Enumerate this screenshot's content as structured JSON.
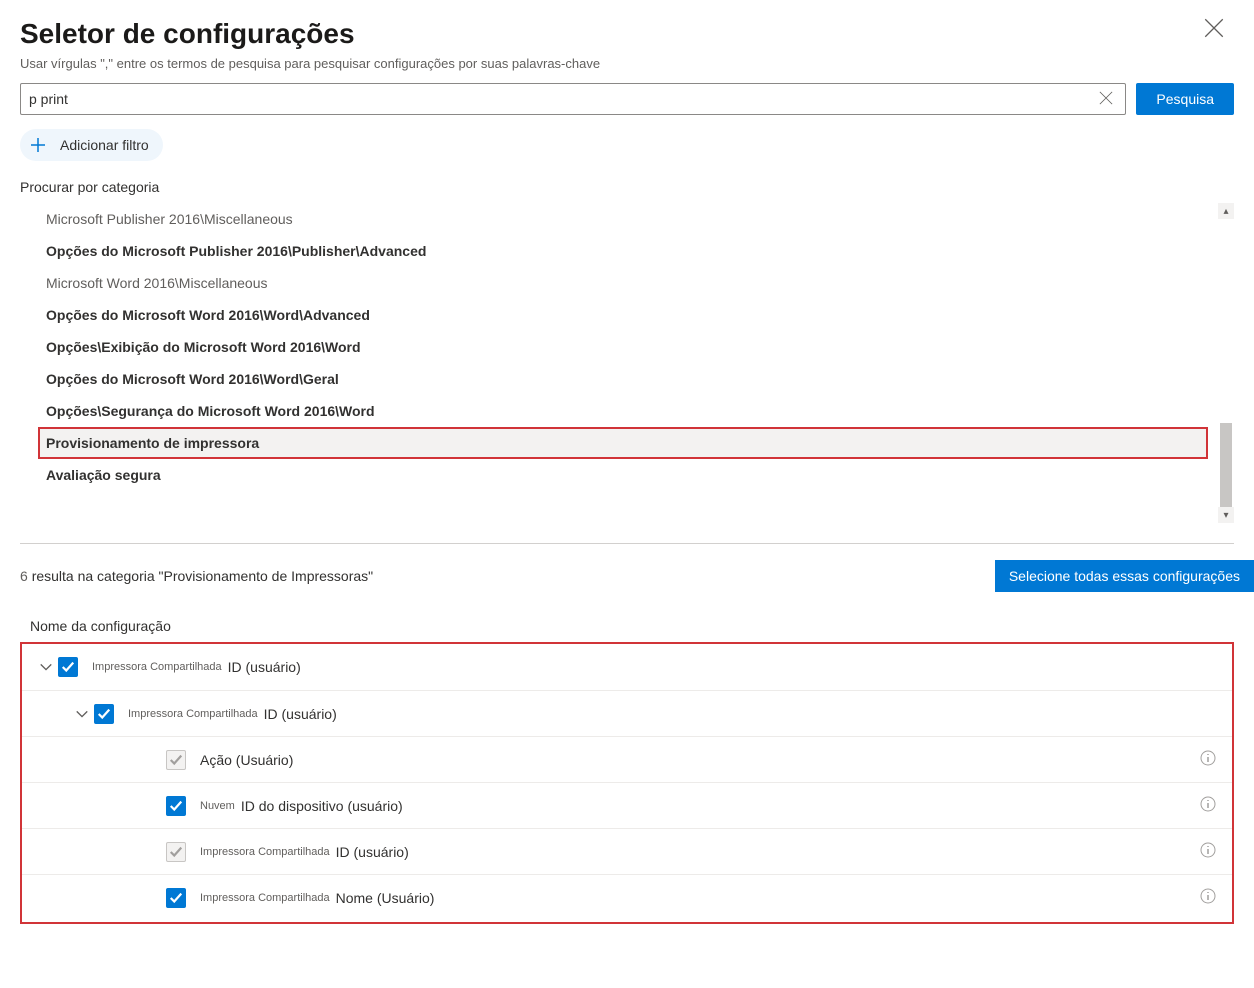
{
  "title": "Seletor de configurações",
  "hint": "Usar vírgulas \",\" entre os termos de pesquisa para pesquisar configurações por suas palavras-chave",
  "search": {
    "value": "p print",
    "button": "Pesquisa"
  },
  "add_filter": "Adicionar filtro",
  "browse_label": "Procurar por categoria",
  "categories": [
    {
      "label": "Microsoft Publisher 2016\\Miscellaneous",
      "style": "light"
    },
    {
      "label": "Opções do Microsoft Publisher 2016\\Publisher\\Advanced",
      "style": "bold"
    },
    {
      "label": "Microsoft Word 2016\\Miscellaneous",
      "style": "light"
    },
    {
      "label": "Opções do Microsoft Word 2016\\Word\\Advanced",
      "style": "bold"
    },
    {
      "label": "Opções\\Exibição do Microsoft Word 2016\\Word",
      "style": "bold"
    },
    {
      "label": "Opções do Microsoft Word 2016\\Word\\Geral",
      "style": "bold"
    },
    {
      "label": "Opções\\Segurança do Microsoft Word 2016\\Word",
      "style": "bold"
    },
    {
      "label": "Provisionamento de impressora",
      "style": "bold",
      "selected": true
    },
    {
      "label": "Avaliação segura",
      "style": "bold"
    }
  ],
  "results_count": "6",
  "results_text": "resulta na categoria \"Provisionamento de Impressoras\"",
  "select_all_button": "Selecione todas essas configurações",
  "column_header": "Nome da configuração",
  "tree": [
    {
      "level": 0,
      "chevron": true,
      "checked": "checked",
      "prefix": "Impressora Compartilhada",
      "label": "ID (usuário)",
      "info": false
    },
    {
      "level": 1,
      "chevron": true,
      "checked": "checked",
      "prefix": "Impressora Compartilhada",
      "label": "ID (usuário)",
      "info": false
    },
    {
      "level": 2,
      "chevron": false,
      "checked": "disabled",
      "prefix": "",
      "label": "Ação (Usuário)",
      "info": true
    },
    {
      "level": 2,
      "chevron": false,
      "checked": "checked",
      "prefix": "Nuvem",
      "label": "ID do dispositivo (usuário)",
      "info": true
    },
    {
      "level": 2,
      "chevron": false,
      "checked": "disabled",
      "prefix": "Impressora Compartilhada",
      "label": "ID (usuário)",
      "info": true
    },
    {
      "level": 2,
      "chevron": false,
      "checked": "checked",
      "prefix": "Impressora Compartilhada",
      "label": "Nome (Usuário)",
      "info": true
    }
  ]
}
